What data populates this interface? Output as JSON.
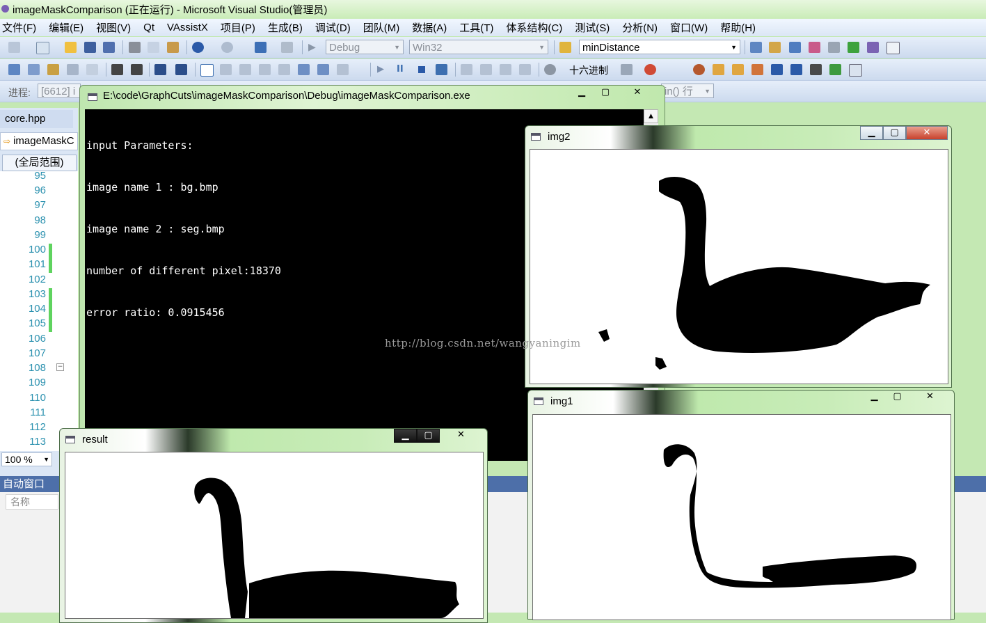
{
  "vs": {
    "title": "imageMaskComparison (正在运行) - Microsoft Visual Studio(管理员)",
    "menu": [
      "文件(F)",
      "编辑(E)",
      "视图(V)",
      "Qt",
      "VAssistX",
      "项目(P)",
      "生成(B)",
      "调试(D)",
      "团队(M)",
      "数据(A)",
      "工具(T)",
      "体系结构(C)",
      "测试(S)",
      "分析(N)",
      "窗口(W)",
      "帮助(H)"
    ],
    "toolbar": {
      "config": "Debug",
      "platform": "Win32",
      "find": "minDistance",
      "hex_label": "十六进制",
      "process_label": "进程:",
      "process_value": "[6612] i",
      "stack_frame": "in() 行"
    },
    "editor": {
      "tab": "core.hpp",
      "nav": "imageMaskC",
      "scope": "(全局范围)",
      "line_numbers": [
        "95",
        "96",
        "97",
        "98",
        "99",
        "100",
        "101",
        "102",
        "103",
        "104",
        "105",
        "106",
        "107",
        "108",
        "109",
        "110",
        "111",
        "112",
        "113"
      ],
      "zoom": "100 %"
    },
    "auto_window": {
      "title": "自动窗口",
      "column_name": "名称"
    }
  },
  "console": {
    "title": "E:\\code\\GraphCuts\\imageMaskComparison\\Debug\\imageMaskComparison.exe",
    "lines": [
      "input Parameters:",
      "image name 1 : bg.bmp",
      "image name 2 : seg.bmp",
      "number of different pixel:18370",
      "error ratio: 0.0915456"
    ]
  },
  "windows": {
    "img2": {
      "title": "img2"
    },
    "img1": {
      "title": "img1"
    },
    "result": {
      "title": "result"
    }
  },
  "watermark": "http://blog.csdn.net/wangyaningim",
  "colors": {
    "title_bar": "#c9ecb7",
    "menu_bg": "#dbe6f5",
    "console_bg": "#000000",
    "line_number": "#2b91af",
    "changed_marker": "#5fd35f",
    "auto_header": "#4d6fa9"
  }
}
